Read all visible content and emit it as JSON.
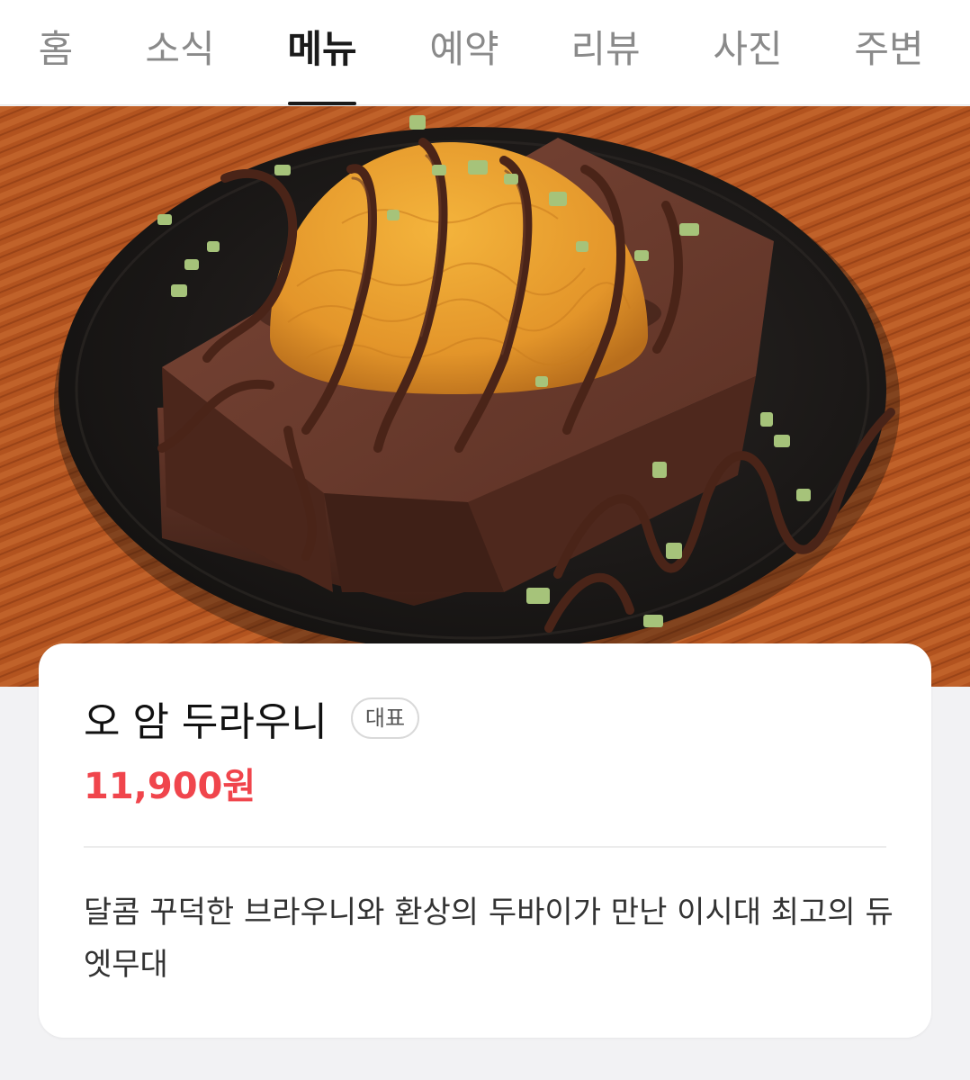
{
  "tabs": [
    {
      "label": "홈",
      "active": false
    },
    {
      "label": "소식",
      "active": false
    },
    {
      "label": "메뉴",
      "active": true
    },
    {
      "label": "예약",
      "active": false
    },
    {
      "label": "리뷰",
      "active": false
    },
    {
      "label": "사진",
      "active": false
    },
    {
      "label": "주변",
      "active": false
    }
  ],
  "hero_image": {
    "description_icon": "brownie-photo"
  },
  "menu_item": {
    "title": "오 암 두라우니",
    "badge": "대표",
    "price": "11,900원",
    "description": "달콤 꾸덕한 브라우니와 환상의 두바이가 만난 이시대 최고의 듀엣무대"
  },
  "colors": {
    "price": "#f0454c",
    "active_tab": "#1a1a1a",
    "inactive_tab": "#8a8a8a"
  }
}
